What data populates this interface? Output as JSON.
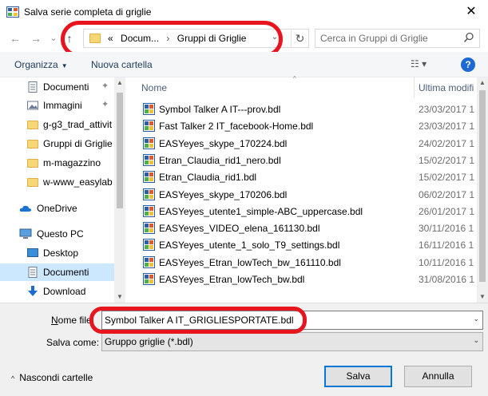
{
  "window": {
    "title": "Salva serie completa di griglie",
    "close_glyph": "✕"
  },
  "nav": {
    "back_icon": "arrow-left-icon",
    "forward_icon": "arrow-right-icon",
    "recent_icon": "chevron-down-icon",
    "up_icon": "arrow-up-icon",
    "back_glyph": "←",
    "forward_glyph": "→",
    "recent_glyph": "⌄",
    "up_glyph": "↑",
    "breadcrumb": {
      "overflow": "«",
      "part1": "Docum...",
      "sep": "›",
      "part2": "Gruppi di Griglie"
    },
    "dropdown_glyph": "⌄",
    "refresh_glyph": "↻",
    "search_placeholder": "Cerca in Gruppi di Griglie"
  },
  "toolbar": {
    "organize_label": "Organizza",
    "organize_arrow": "▼",
    "new_folder_label": "Nuova cartella",
    "view_glyph": "☷ ▾",
    "help_glyph": "?"
  },
  "sidebar": {
    "items": [
      {
        "label": "Documenti",
        "icon": "document-icon",
        "pinned": true,
        "pin_glyph": "✦"
      },
      {
        "label": "Immagini",
        "icon": "image-icon",
        "pinned": true,
        "pin_glyph": "✦"
      },
      {
        "label": "g-g3_trad_attivit",
        "icon": "folder-icon"
      },
      {
        "label": "Gruppi di Griglie",
        "icon": "folder-icon"
      },
      {
        "label": "m-magazzino",
        "icon": "folder-icon"
      },
      {
        "label": "w-www_easylab",
        "icon": "folder-icon"
      },
      {
        "label": "OneDrive",
        "icon": "cloud-icon"
      },
      {
        "label": "Questo PC",
        "icon": "computer-icon"
      },
      {
        "label": "Desktop",
        "icon": "desktop-icon"
      },
      {
        "label": "Documenti",
        "icon": "document-icon",
        "selected": true
      },
      {
        "label": "Download",
        "icon": "download-icon"
      }
    ],
    "scroll_up": "▲",
    "scroll_down": "▼"
  },
  "files": {
    "columns": {
      "name": "Nome",
      "date": "Ultima modifi",
      "sort_glyph": "^"
    },
    "rows": [
      {
        "name": "Symbol Talker A IT---prov.bdl",
        "date": "23/03/2017 1"
      },
      {
        "name": "Fast Talker 2 IT_facebook-Home.bdl",
        "date": "23/03/2017 1"
      },
      {
        "name": "EASYeyes_skype_170224.bdl",
        "date": "24/02/2017 1"
      },
      {
        "name": "Etran_Claudia_rid1_nero.bdl",
        "date": "15/02/2017 1"
      },
      {
        "name": "Etran_Claudia_rid1.bdl",
        "date": "15/02/2017 1"
      },
      {
        "name": "EASYeyes_skype_170206.bdl",
        "date": "06/02/2017 1"
      },
      {
        "name": "EASYeyes_utente1_simple-ABC_uppercase.bdl",
        "date": "26/01/2017 1"
      },
      {
        "name": "EASYeyes_VIDEO_elena_161130.bdl",
        "date": "30/11/2016 1"
      },
      {
        "name": "EASYeyes_utente_1_solo_T9_settings.bdl",
        "date": "16/11/2016 1"
      },
      {
        "name": "EASYeyes_Etran_lowTech_bw_161110.bdl",
        "date": "10/11/2016 1"
      },
      {
        "name": "EASYeyes_Etran_lowTech_bw.bdl",
        "date": "31/08/2016 1"
      }
    ],
    "scroll_up": "▲",
    "scroll_down": "▼"
  },
  "form": {
    "name_label_underlined": "N",
    "name_label_rest": "ome file:",
    "name_value": "Symbol Talker A IT_GRIGLIESPORTATE.bdl",
    "type_label": "Salva come:",
    "type_value": "Gruppo griglie (*.bdl)",
    "dropdown_glyph": "⌄",
    "hide_folders_chevron": "^",
    "hide_folders_label": "Nascondi cartelle",
    "save_label": "Salva",
    "cancel_label": "Annulla"
  },
  "colors": {
    "annotation": "#e8141e",
    "selection": "#cce8ff",
    "accent": "#0078d7"
  }
}
